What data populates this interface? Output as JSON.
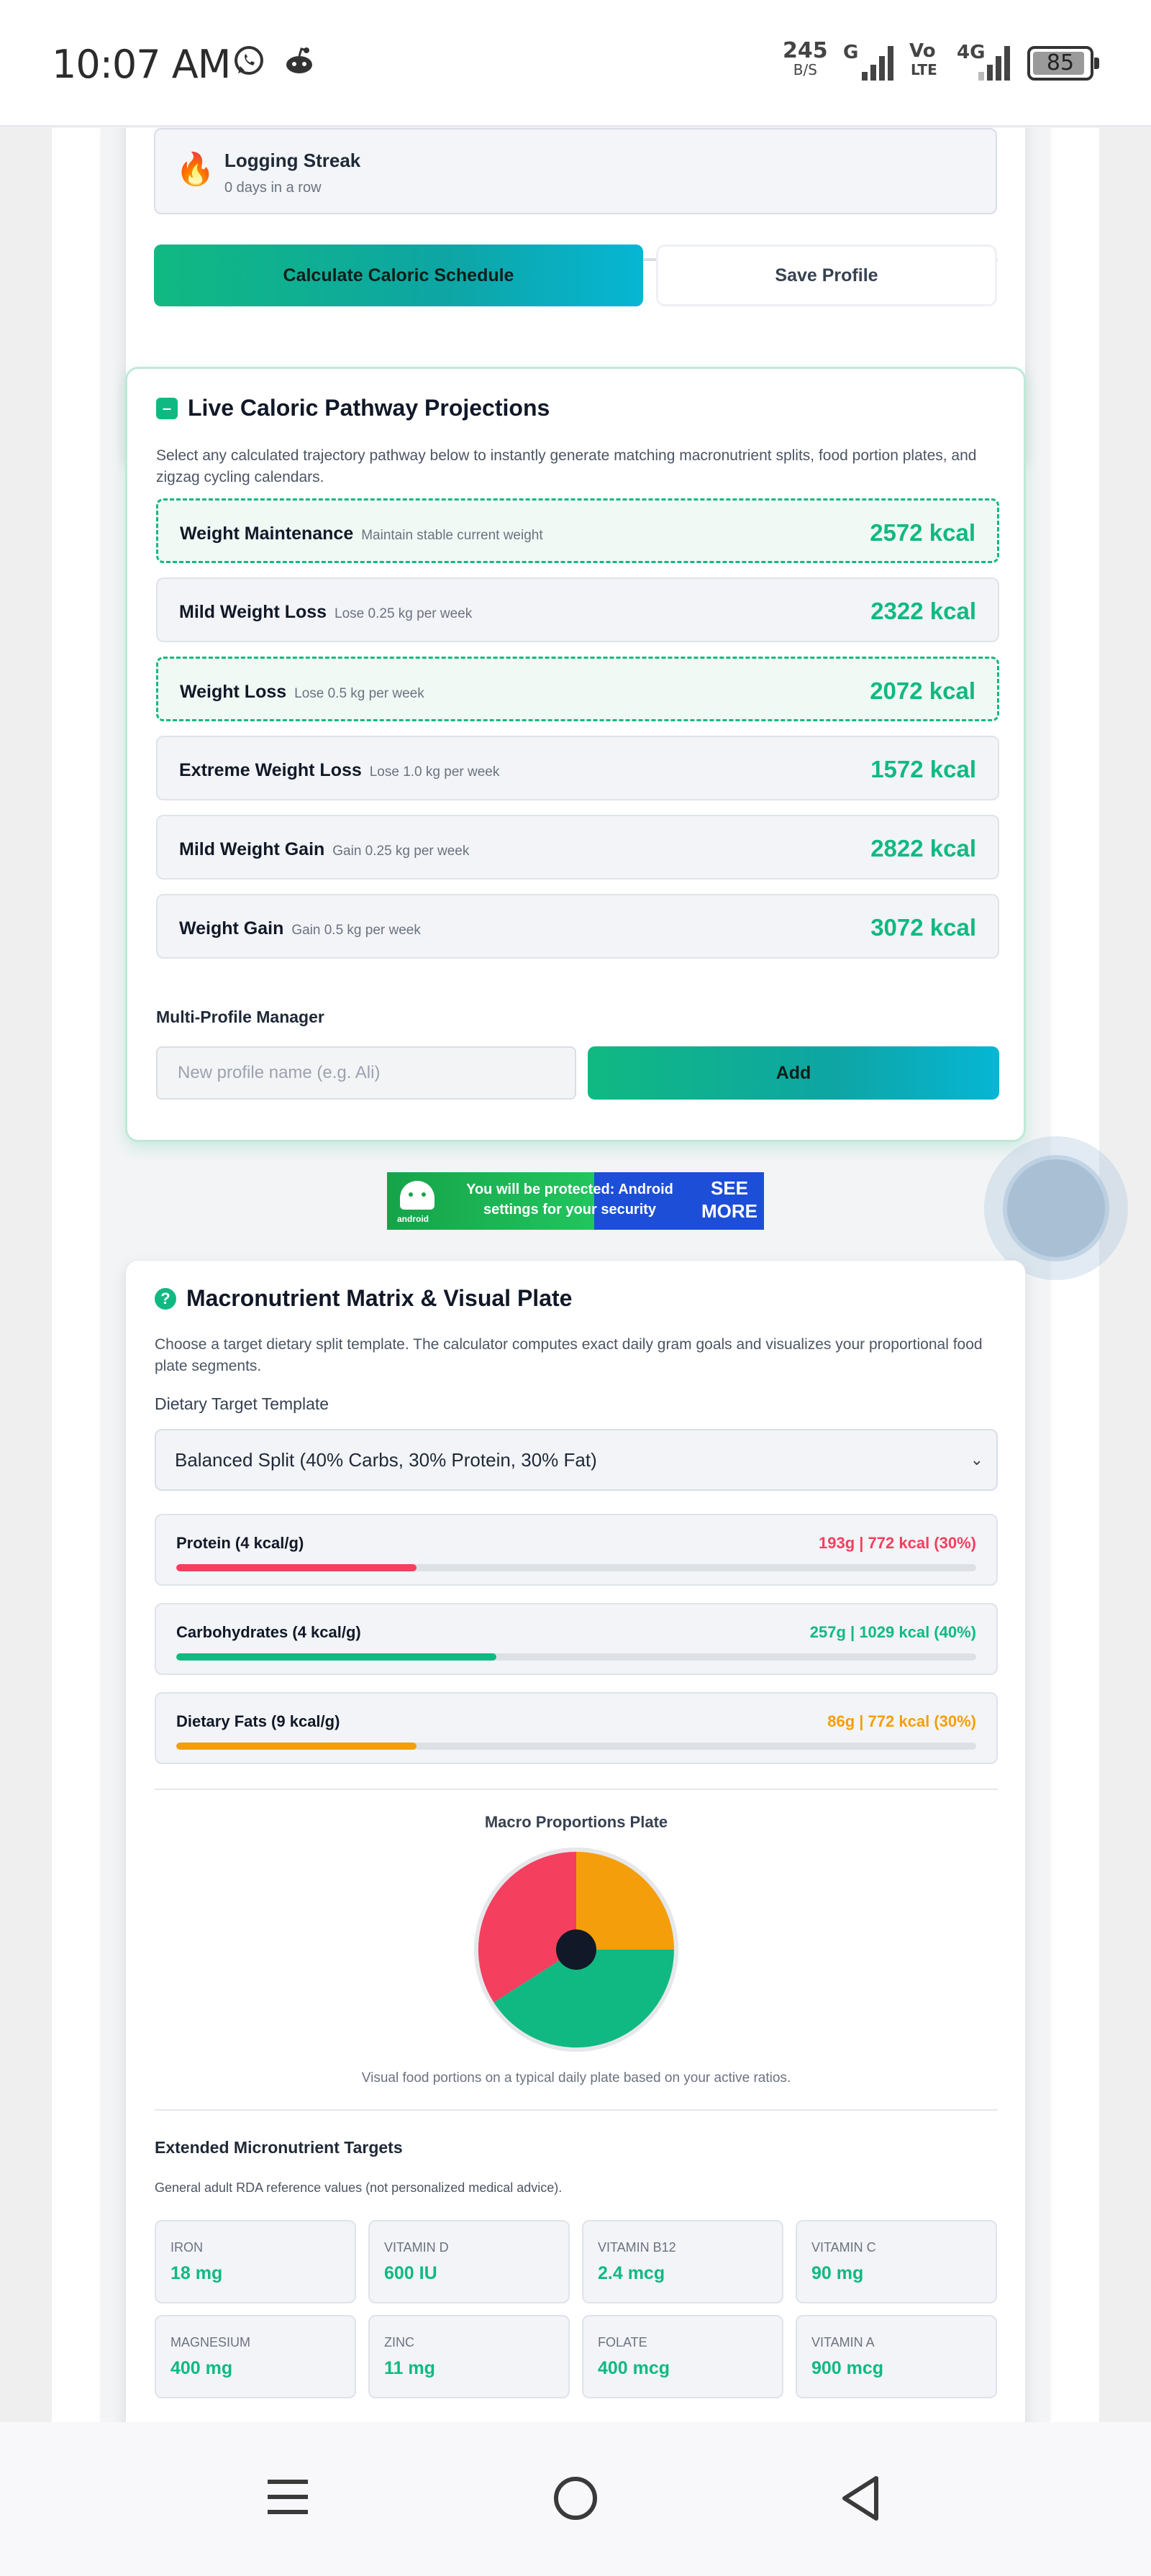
{
  "status_bar": {
    "time": "10:07 AM",
    "net_speed": "245",
    "net_unit": "B/S",
    "sim1_label": "G",
    "volte_label": "Vo",
    "volte_sub": "LTE",
    "sim2_label": "4G",
    "battery": "85",
    "battery_fraction": 0.85
  },
  "streak": {
    "icon": "fire-icon",
    "title": "Logging Streak",
    "subtitle": "0 days in a row"
  },
  "actions": {
    "calculate_label": "Calculate Caloric Schedule",
    "save_label": "Save Profile"
  },
  "pathways": {
    "title": "Live Caloric Pathway Projections",
    "description": "Select any calculated trajectory pathway below to instantly generate matching macronutrient splits, food portion plates, and zigzag cycling calendars.",
    "items": [
      {
        "name": "Weight Maintenance",
        "desc": "Maintain stable current weight",
        "kcal": "2572 kcal",
        "selected": true
      },
      {
        "name": "Mild Weight Loss",
        "desc": "Lose 0.25 kg per week",
        "kcal": "2322 kcal",
        "selected": false
      },
      {
        "name": "Weight Loss",
        "desc": "Lose 0.5 kg per week",
        "kcal": "2072 kcal",
        "selected": true
      },
      {
        "name": "Extreme Weight Loss",
        "desc": "Lose 1.0 kg per week",
        "kcal": "1572 kcal",
        "selected": false
      },
      {
        "name": "Mild Weight Gain",
        "desc": "Gain 0.25 kg per week",
        "kcal": "2822 kcal",
        "selected": false
      },
      {
        "name": "Weight Gain",
        "desc": "Gain 0.5 kg per week",
        "kcal": "3072 kcal",
        "selected": false
      }
    ]
  },
  "profiles": {
    "label": "Multi-Profile Manager",
    "input_placeholder": "New profile name (e.g. Ali)",
    "add_label": "Add"
  },
  "ad": {
    "text": "You will be protected: Android settings for your security",
    "cta": "SEE MORE",
    "brand": "android"
  },
  "macros": {
    "title": "Macronutrient Matrix & Visual Plate",
    "description": "Choose a target dietary split template. The calculator computes exact daily gram goals and visualizes your proportional food plate segments.",
    "template_label": "Dietary Target Template",
    "template_selected": "Balanced Split (40% Carbs, 30% Protein, 30% Fat)",
    "items": [
      {
        "name": "Protein (4 kcal/g)",
        "value": "193g | 772 kcal (30%)",
        "fraction": 0.3,
        "color": "#f43f5e"
      },
      {
        "name": "Carbohydrates (4 kcal/g)",
        "value": "257g | 1029 kcal (40%)",
        "fraction": 0.4,
        "color": "#10b981"
      },
      {
        "name": "Dietary Fats (9 kcal/g)",
        "value": "86g | 772 kcal (30%)",
        "fraction": 0.3,
        "color": "#f59e0b"
      }
    ],
    "plate_title": "Macro Proportions Plate",
    "plate_caption": "Visual food portions on a typical daily plate based on your active ratios."
  },
  "micronutrients": {
    "title": "Extended Micronutrient Targets",
    "note": "General adult RDA reference values (not personalized medical advice).",
    "items": [
      {
        "label": "IRON",
        "value": "18 mg"
      },
      {
        "label": "VITAMIN D",
        "value": "600 IU"
      },
      {
        "label": "VITAMIN B12",
        "value": "2.4 mcg"
      },
      {
        "label": "VITAMIN C",
        "value": "90 mg"
      },
      {
        "label": "MAGNESIUM",
        "value": "400 mg"
      },
      {
        "label": "ZINC",
        "value": "11 mg"
      },
      {
        "label": "FOLATE",
        "value": "400 mcg"
      },
      {
        "label": "VITAMIN A",
        "value": "900 mcg"
      }
    ]
  },
  "nav": {
    "recents_icon": "recents-icon",
    "home_icon": "home-icon",
    "back_icon": "back-icon"
  }
}
